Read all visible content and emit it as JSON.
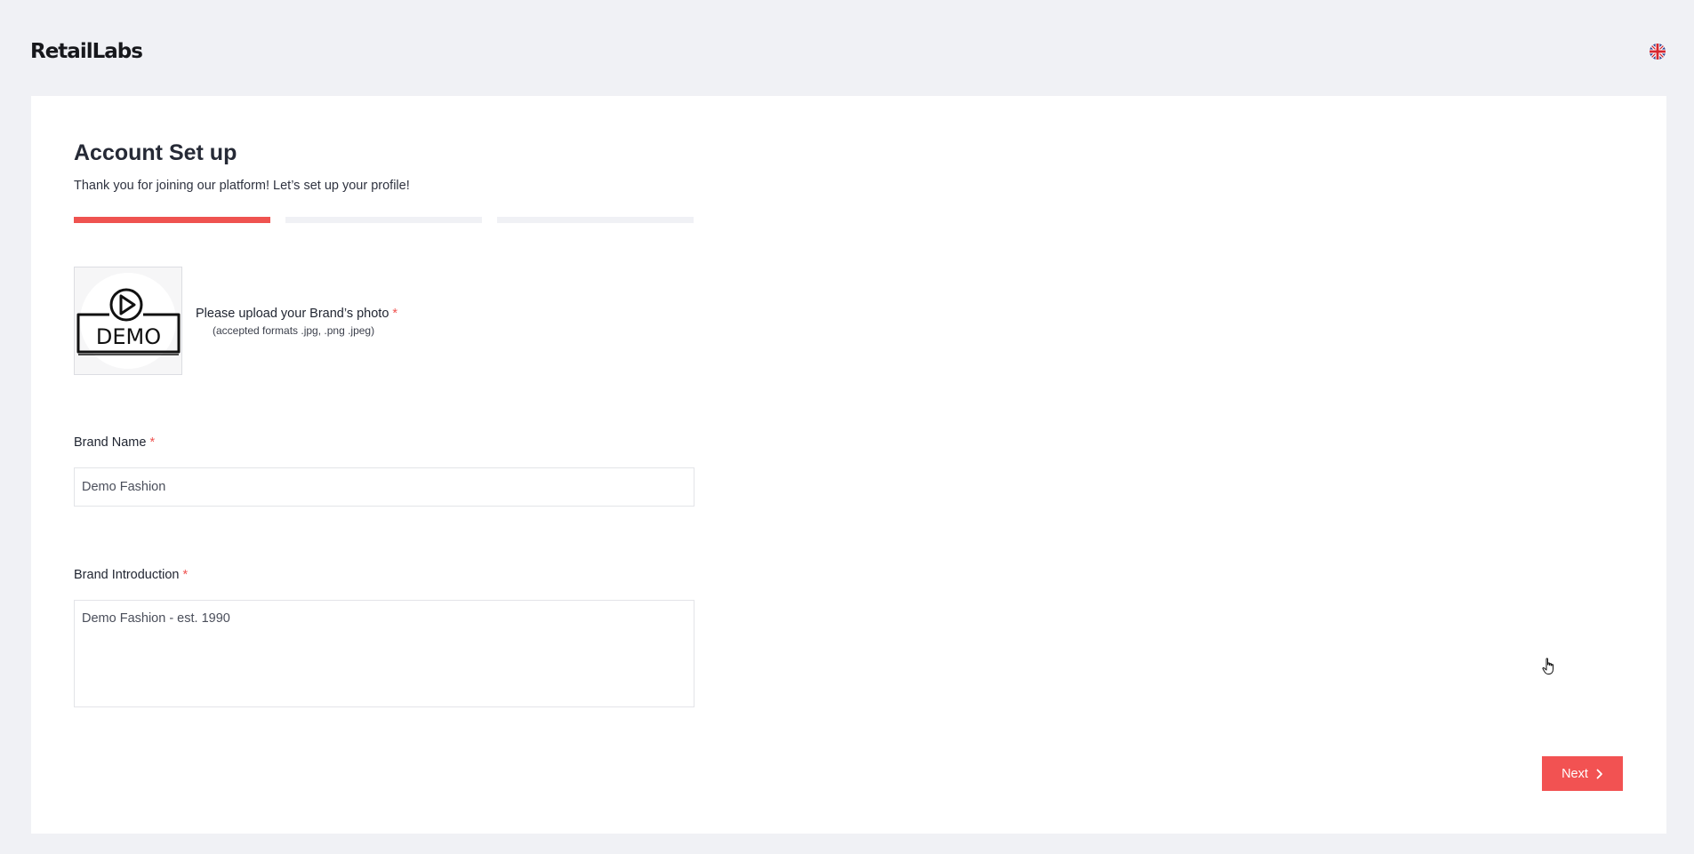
{
  "header": {
    "logo_text": "RetailLabs",
    "language_icon": "uk-flag-icon"
  },
  "setup": {
    "title": "Account Set up",
    "subtitle": "Thank you for joining our platform! Let’s set up your profile!",
    "progress": {
      "total_steps": 3,
      "current_step": 1
    },
    "photo": {
      "label": "Please upload your Brand’s photo",
      "required_mark": "*",
      "hint": "(accepted formats .jpg, .png .jpeg)",
      "image_text": "DEMO",
      "image_icon": "play-icon"
    },
    "brand_name": {
      "label": "Brand Name",
      "required_mark": "*",
      "value": "Demo Fashion"
    },
    "brand_intro": {
      "label": "Brand Introduction",
      "required_mark": "*",
      "value": "Demo Fashion - est. 1990"
    },
    "next_button": {
      "label": "Next",
      "icon": "chevron-right-icon"
    }
  },
  "colors": {
    "accent": "#ef5350",
    "page_background": "#f0f1f5",
    "card_background": "#ffffff"
  }
}
